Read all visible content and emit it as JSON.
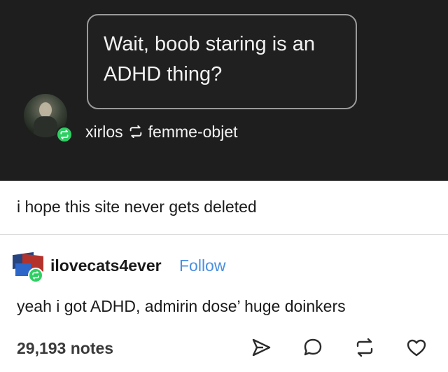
{
  "ask": {
    "question": "Wait, boob staring is an ADHD thing?"
  },
  "reblog_trail": {
    "reblogger": "xirlos",
    "source": "femme-objet"
  },
  "caption": "i hope this site never gets deleted",
  "reply": {
    "username": "ilovecats4ever",
    "follow_label": "Follow",
    "text": "yeah i got ADHD, admirin dose’ huge doinkers"
  },
  "footer": {
    "notes": "29,193 notes",
    "actions": [
      "share-icon",
      "comment-icon",
      "reblog-icon",
      "heart-icon"
    ]
  },
  "colors": {
    "dark_background": "#1e1e1e",
    "reblog_green": "#2ecf62",
    "follow_blue": "#4a8fe0"
  }
}
